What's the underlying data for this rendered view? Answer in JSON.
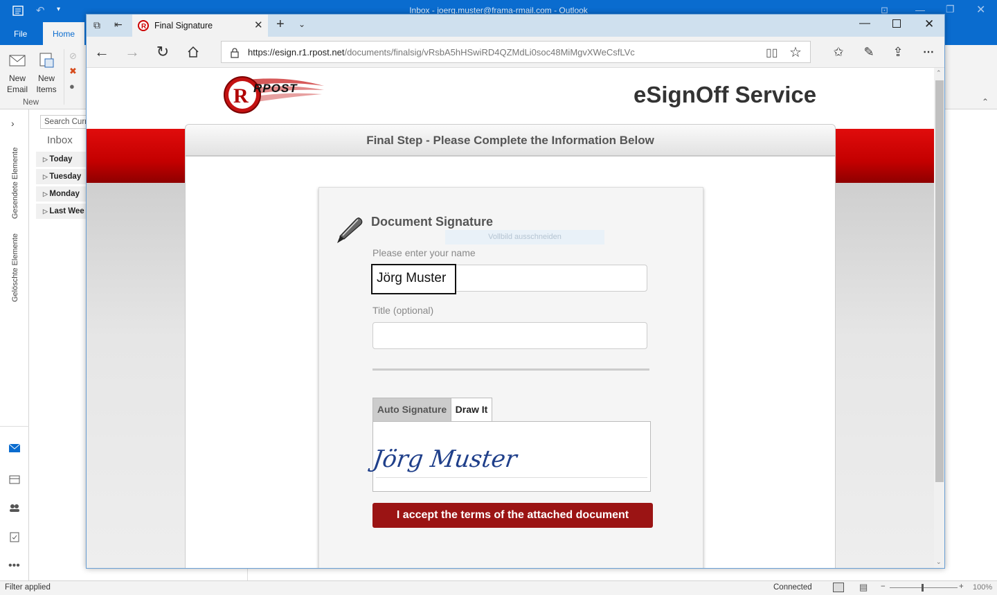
{
  "outlook": {
    "window_title": "Inbox - joerg.muster@frama-rmail.com - Outlook",
    "tabs": [
      "File",
      "Home"
    ],
    "ribbon": {
      "new_email": "New Email",
      "new_items": "New Items",
      "group_new": "New"
    },
    "search_placeholder": "Search Curr",
    "inbox_label": "Inbox",
    "groups": [
      "Today",
      "Tuesday",
      "Monday",
      "Last Wee"
    ],
    "nav_labels": [
      "Gesendete Elemente",
      "Gelöschte Elemente"
    ],
    "status_left": "Filter applied",
    "status_connected": "Connected",
    "zoom": "100%"
  },
  "browser": {
    "tab_title": "Final Signature",
    "url_host": "https://esign.r1.rpost.net",
    "url_path": "/documents/finalsig/vRsbA5hHSwiRD4QZMdLi0soc48MiMgvXWeCsfLVc"
  },
  "page": {
    "logo_text": "RPOST",
    "service_title": "eSignOff Service",
    "panel_heading": "Final Step - Please Complete the Information Below",
    "section_title": "Document Signature",
    "overlay_hint": "Vollbild ausschneiden",
    "name_label": "Please enter your name",
    "name_value": "Jörg Muster",
    "title_label": "Title (optional)",
    "title_value": "",
    "sig_tabs": [
      "Auto Signature",
      "Draw It"
    ],
    "signature_text": "Jörg Muster",
    "accept_button": "I accept the terms of the attached document"
  },
  "colors": {
    "outlook_blue": "#0a6ccf",
    "rpost_red": "#c40000",
    "accept_red": "#9b1414"
  }
}
